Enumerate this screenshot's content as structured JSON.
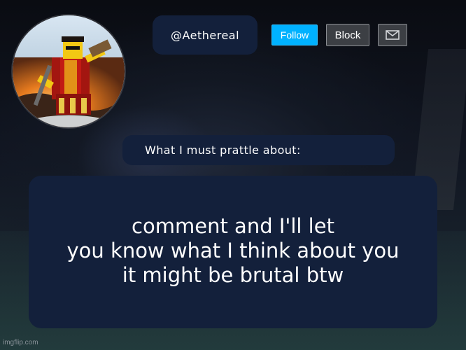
{
  "profile": {
    "username": "@Aethereal",
    "avatar_icon": "roblox-avatar-icon"
  },
  "actions": {
    "follow_label": "Follow",
    "block_label": "Block",
    "message_icon": "mail-icon"
  },
  "about": {
    "heading": "What I must prattle about:",
    "lines": [
      "comment and I'll let",
      "you know what I think about you",
      "it might be brutal btw"
    ]
  },
  "watermark": "imgflip.com",
  "colors": {
    "panel": "#13203b",
    "follow": "#00b2ff",
    "block": "#3c3f44"
  }
}
